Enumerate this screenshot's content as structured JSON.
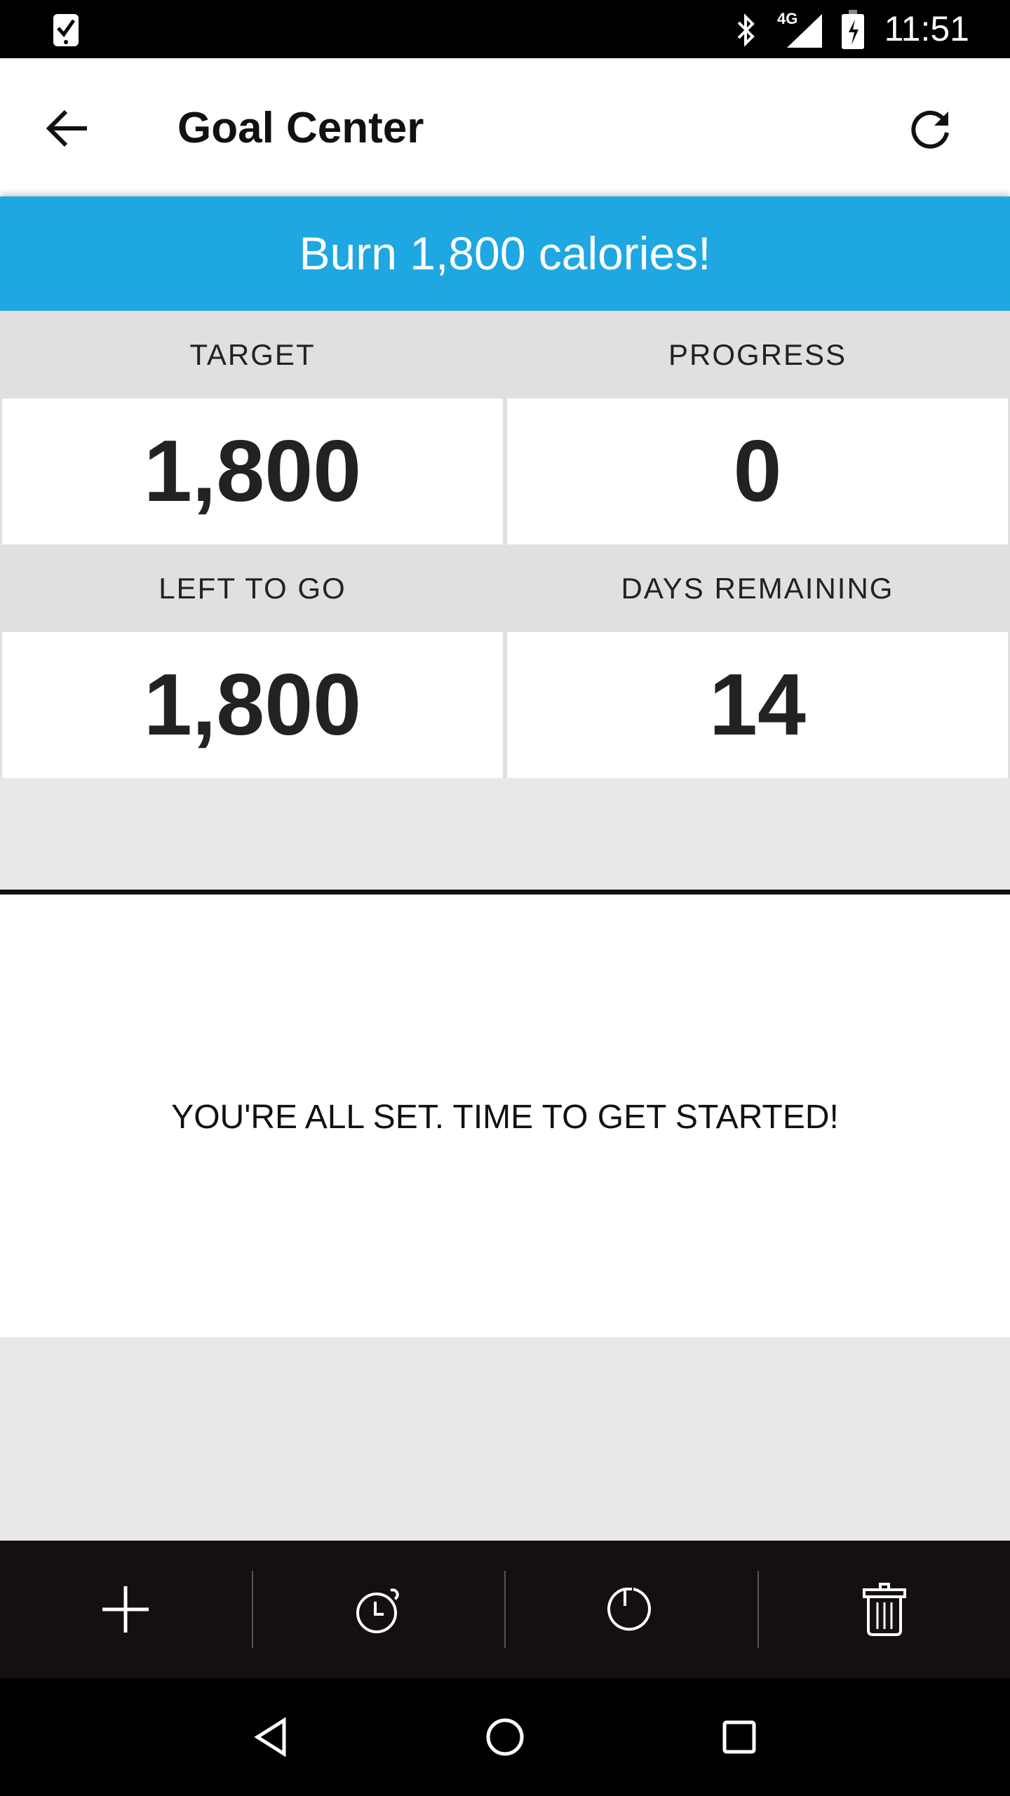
{
  "status_bar": {
    "time": "11:51",
    "network": "4G",
    "icons": [
      "task-check-icon",
      "bluetooth-icon",
      "signal-icon",
      "battery-charging-icon"
    ]
  },
  "app_bar": {
    "title": "Goal Center",
    "icons": [
      "back-arrow-icon",
      "refresh-icon"
    ]
  },
  "banner": {
    "text": "Burn 1,800 calories!",
    "color": "#1ea7e1"
  },
  "stats": {
    "target": {
      "label": "TARGET",
      "value": "1,800"
    },
    "progress": {
      "label": "PROGRESS",
      "value": "0"
    },
    "left_to_go": {
      "label": "LEFT TO GO",
      "value": "1,800"
    },
    "days_remaining": {
      "label": "DAYS REMAINING",
      "value": "14"
    }
  },
  "message": "YOU'RE ALL SET. TIME TO GET STARTED!",
  "toolbar": {
    "icons": [
      "plus-icon",
      "timer-icon",
      "reset-icon",
      "trash-icon"
    ]
  },
  "nav_bar": {
    "icons": [
      "back-icon",
      "home-icon",
      "recents-icon"
    ]
  }
}
